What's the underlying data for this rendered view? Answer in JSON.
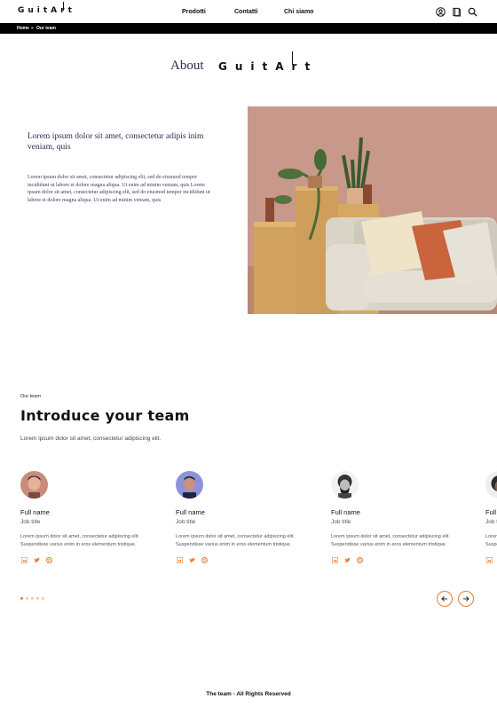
{
  "header": {
    "logo": "GuitArt",
    "nav": [
      "Prodotti",
      "Contatti",
      "Chi siamo"
    ],
    "icons": [
      "user-icon",
      "book-icon",
      "search-icon"
    ]
  },
  "breadcrumb": {
    "home": "Home",
    "separator": "»",
    "current": "Our team"
  },
  "about": {
    "title": "About",
    "logo": "GuitArt"
  },
  "intro": {
    "heading": "Lorem ipsum dolor sit amet, consectetur adipis inim veniam, quis",
    "body": "Lorem ipsum dolor sit amet, consectetur adipiscing elit, sed do eiusmod tempor incididunt ut labore et dolore magna aliqua. Ut enim ad minim veniam, quis Lorem ipsum dolor sit amet, consectetur adipiscing elit, sed do eiusmod tempor incididunt ut labore et dolore magna aliqua. Ut enim ad minim veniam, quis"
  },
  "team": {
    "eyebrow": "Our team",
    "title": "Introduce your team",
    "subtitle": "Lorem ipsum dolor sit amet, consectetur adipiscing elit.",
    "members": [
      {
        "name": "Full name",
        "job": "Job title",
        "desc": "Lorem ipsum dolor sit amet, consectetur adipiscing elit. Suspendisse varius enim in eros elementum tristique."
      },
      {
        "name": "Full name",
        "job": "Job title",
        "desc": "Lorem ipsum dolor sit amet, consectetur adipiscing elit. Suspendisse varius enim in eros elementum tristique."
      },
      {
        "name": "Full name",
        "job": "Job title",
        "desc": "Lorem ipsum dolor sit amet, consectetur adipiscing elit. Suspendisse varius enim in eros elementum tristique."
      },
      {
        "name": "Full name",
        "job": "Job title",
        "desc": "Lorem ipsum dolor sit amet, consectetur adipiscing elit. Suspendisse varius enim in eros elementum tristique."
      }
    ],
    "social_icons": [
      "linkedin-icon",
      "twitter-icon",
      "dribbble-icon"
    ],
    "pagination": {
      "total": 5,
      "active": 1
    }
  },
  "footer": {
    "text": "The team - All Rights Reserved"
  },
  "colors": {
    "accent": "#e87d34",
    "breadcrumb_bg": "#000000",
    "heading_serif": "#2b2d4a"
  }
}
